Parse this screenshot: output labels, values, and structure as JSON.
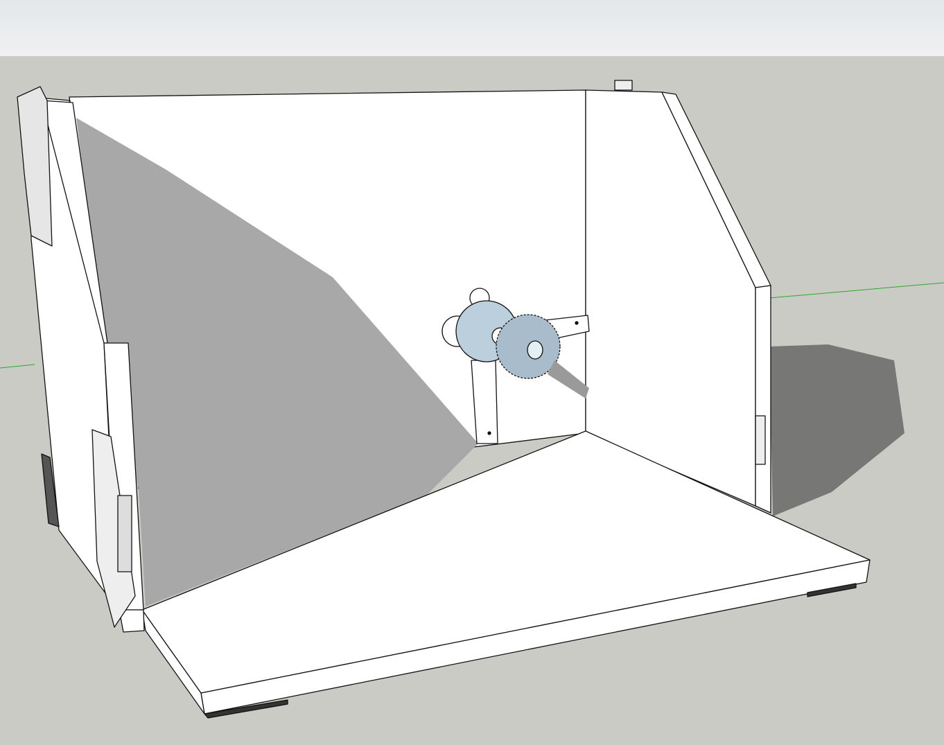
{
  "app": {
    "toolbar": {}
  },
  "colors": {
    "sky": "#e8ebec",
    "ground": "#cbcbc6",
    "face": "#ffffff",
    "shadow_on_wall": "#a8a8a8",
    "shadow_on_ground": "#777775",
    "axis_green": "#2aa82a",
    "spool": "#b9ccd9"
  },
  "scene": {
    "description_icons": [
      "spool-holder-model",
      "bracket-icon"
    ]
  }
}
